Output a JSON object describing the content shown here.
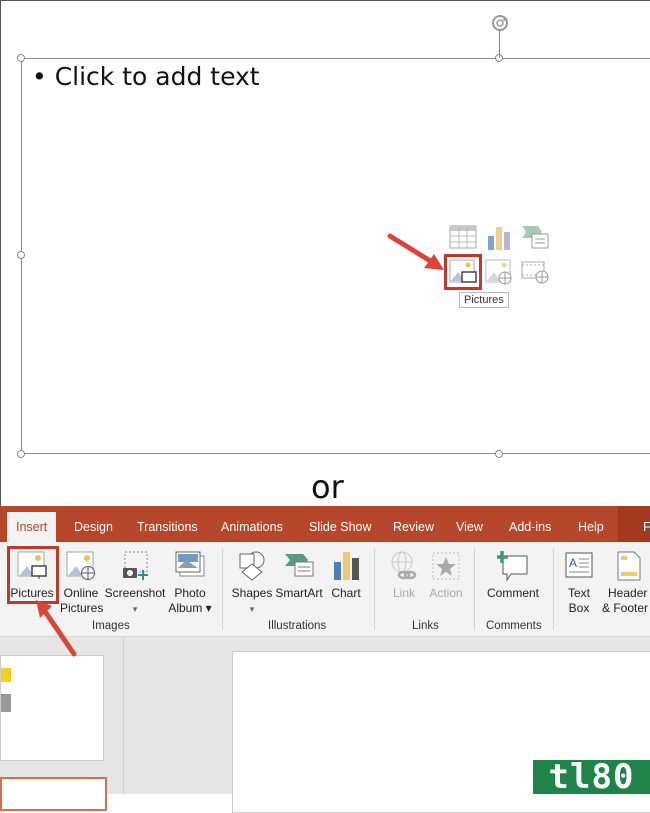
{
  "slide_editor": {
    "placeholder_text": "Click to add text",
    "bullet": "•",
    "content_icons": [
      {
        "name": "insert-table-icon"
      },
      {
        "name": "insert-chart-icon"
      },
      {
        "name": "insert-smartart-icon"
      },
      {
        "name": "pictures-icon",
        "highlighted": true
      },
      {
        "name": "online-pictures-icon"
      },
      {
        "name": "insert-video-icon"
      }
    ],
    "tooltip": "Pictures"
  },
  "separator_text": "or",
  "ribbon": {
    "tabs": [
      {
        "label": "Insert",
        "active": true
      },
      {
        "label": "Design"
      },
      {
        "label": "Transitions"
      },
      {
        "label": "Animations"
      },
      {
        "label": "Slide Show"
      },
      {
        "label": "Review"
      },
      {
        "label": "View"
      },
      {
        "label": "Add-ins"
      },
      {
        "label": "Help"
      },
      {
        "label": "F"
      }
    ],
    "groups": {
      "images": {
        "label": "Images",
        "buttons": {
          "pictures": {
            "label": "Pictures",
            "highlighted": true
          },
          "online_pictures": {
            "line1": "Online",
            "line2": "Pictures"
          },
          "screenshot": {
            "label": "Screenshot",
            "dropdown": "▾"
          },
          "photo_album": {
            "line1": "Photo",
            "line2": "Album ▾"
          }
        }
      },
      "illustrations": {
        "label": "Illustrations",
        "buttons": {
          "shapes": {
            "label": "Shapes",
            "dropdown": "▾"
          },
          "smartart": {
            "label": "SmartArt"
          },
          "chart": {
            "label": "Chart"
          }
        }
      },
      "links": {
        "label": "Links",
        "buttons": {
          "link": {
            "label": "Link",
            "disabled": true
          },
          "action": {
            "label": "Action",
            "disabled": true
          }
        }
      },
      "comments": {
        "label": "Comments",
        "buttons": {
          "comment": {
            "label": "Comment"
          }
        }
      },
      "text": {
        "buttons": {
          "text_box": {
            "line1": "Text",
            "line2": "Box"
          },
          "header_footer": {
            "line1": "Header",
            "line2": "& Footer"
          }
        }
      }
    }
  },
  "watermark": "tl80",
  "colors": {
    "accent": "#b7472a",
    "highlight_box": "#c0392b",
    "arrow": "#d9453a",
    "watermark_bg": "#1e8449"
  }
}
